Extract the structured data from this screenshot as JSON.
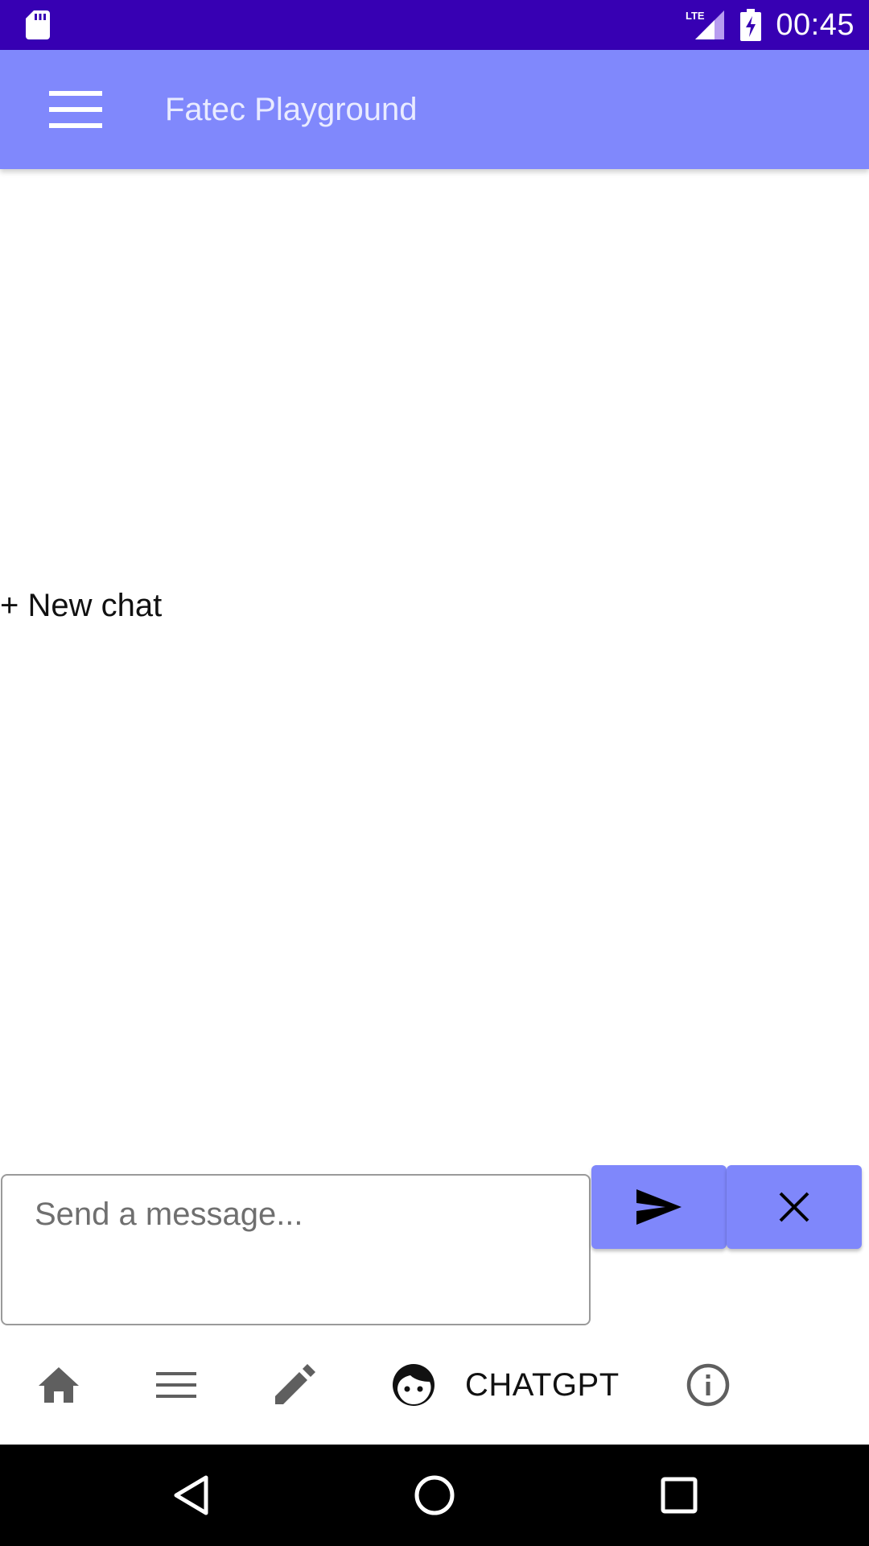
{
  "status_bar": {
    "time": "00:45",
    "network_label": "LTE",
    "icons": [
      "sd-card-icon",
      "lte-signal-icon",
      "battery-charging-icon"
    ]
  },
  "app_bar": {
    "title": "Fatec Playground",
    "menu_icon": "hamburger-menu-icon",
    "background": "#8088fc"
  },
  "content": {
    "new_chat_label": "+ New chat"
  },
  "composer": {
    "value": "",
    "placeholder": "Send a message...",
    "send_icon": "send-icon",
    "close_icon": "close-icon",
    "button_color": "#7f87fb"
  },
  "bottom_nav": {
    "items": [
      {
        "icon": "home-icon"
      },
      {
        "icon": "list-icon"
      },
      {
        "icon": "edit-pencil-icon"
      },
      {
        "icon": "face-icon",
        "label": "CHATGPT"
      },
      {
        "icon": "info-icon"
      }
    ]
  },
  "system_nav": {
    "icons": [
      "back-icon",
      "home-circle-icon",
      "recents-icon"
    ]
  },
  "colors": {
    "status_bar": "#3700b3",
    "accent": "#8088fc"
  }
}
